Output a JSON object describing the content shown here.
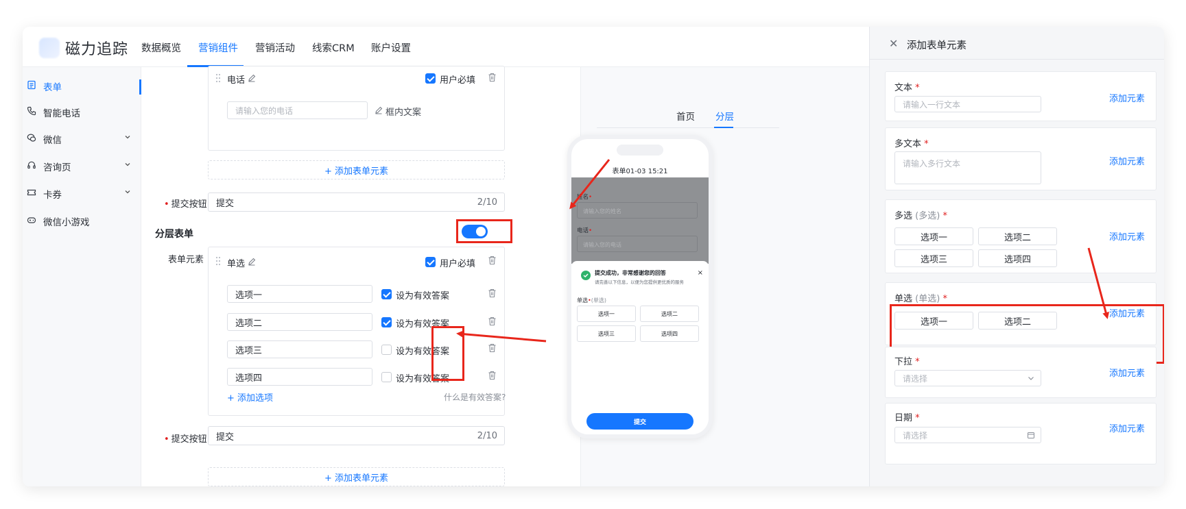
{
  "header": {
    "logo_text": "磁力追踪",
    "nav": [
      {
        "label": "数据概览",
        "active": false
      },
      {
        "label": "营销组件",
        "active": true
      },
      {
        "label": "营销活动",
        "active": false
      },
      {
        "label": "线索CRM",
        "active": false
      },
      {
        "label": "账户设置",
        "active": false
      }
    ]
  },
  "sidebar": {
    "items": [
      {
        "label": "表单",
        "icon": "form-icon",
        "active": true,
        "has_chevron": false
      },
      {
        "label": "智能电话",
        "icon": "phone-icon",
        "active": false,
        "has_chevron": false
      },
      {
        "label": "微信",
        "icon": "wechat-icon",
        "active": false,
        "has_chevron": true
      },
      {
        "label": "咨询页",
        "icon": "headset-icon",
        "active": false,
        "has_chevron": true
      },
      {
        "label": "卡券",
        "icon": "coupon-icon",
        "active": false,
        "has_chevron": true
      },
      {
        "label": "微信小游戏",
        "icon": "gamepad-icon",
        "active": false,
        "has_chevron": false
      }
    ]
  },
  "editor": {
    "phone_field": {
      "title": "电话",
      "required_label": "用户必填",
      "required_checked": true,
      "placeholder": "请输入您的电话",
      "inner_text_label": "框内文案"
    },
    "add_element_label": "+ 添加表单元素",
    "submit_label": "提交按钮",
    "submit_value": "提交",
    "submit_count": "2/10",
    "layered_title": "分层表单",
    "layered_enabled": true,
    "form_elements_label": "表单元素",
    "radio_field": {
      "title": "单选",
      "required_label": "用户必填",
      "required_checked": true,
      "options": [
        {
          "value": "选项一",
          "valid": true
        },
        {
          "value": "选项二",
          "valid": true
        },
        {
          "value": "选项三",
          "valid": false
        },
        {
          "value": "选项四",
          "valid": false
        }
      ],
      "valid_answer_label": "设为有效答案",
      "add_option_label": "+ 添加选项",
      "help_label": "什么是有效答案?"
    },
    "add_element_label_2": "+ 添加表单元素",
    "submit_label_2": "提交按钮",
    "submit_value_2": "提交",
    "submit_count_2": "2/10"
  },
  "preview": {
    "tabs": [
      {
        "label": "首页",
        "active": false
      },
      {
        "label": "分层",
        "active": true
      }
    ],
    "phone": {
      "title": "表单01-03 15:21",
      "name_label": "姓名",
      "name_placeholder": "请输入您的姓名",
      "phone_label": "电话",
      "phone_placeholder": "请输入您的电话",
      "success_title": "提交成功，非常感谢您的回答",
      "success_sub": "请完善以下信息，以便为您提供更优质的服务",
      "radio_label": "单选",
      "radio_tag": "(单选)",
      "options": [
        "选项一",
        "选项二",
        "选项三",
        "选项四"
      ],
      "submit": "提交"
    }
  },
  "drawer": {
    "title": "添加表单元素",
    "add_label": "添加元素",
    "items": [
      {
        "label": "文本",
        "placeholder": "请输入一行文本"
      },
      {
        "label": "多文本",
        "placeholder": "请输入多行文本"
      },
      {
        "label": "多选",
        "tag": "(多选)",
        "options": [
          "选项一",
          "选项二",
          "选项三",
          "选项四"
        ]
      },
      {
        "label": "单选",
        "tag": "(单选)",
        "options": [
          "选项一",
          "选项二"
        ]
      },
      {
        "label": "下拉",
        "placeholder": "请选择"
      },
      {
        "label": "日期",
        "placeholder": "请选择"
      }
    ]
  },
  "colors": {
    "accent": "#1677ff",
    "annotation": "#e8261b"
  }
}
